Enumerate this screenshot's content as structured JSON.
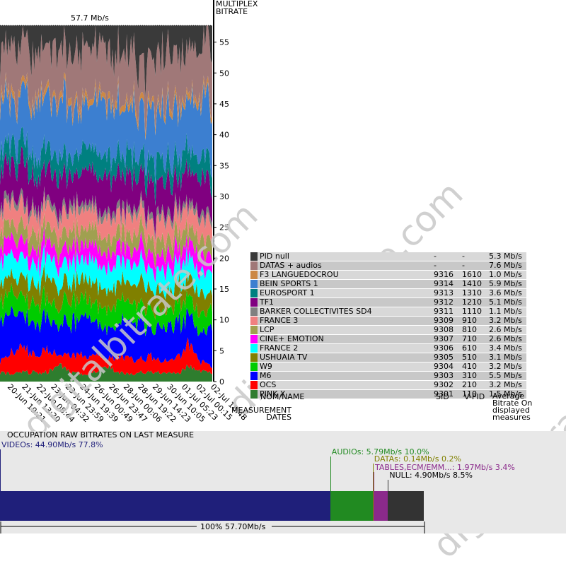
{
  "chart_data": {
    "type": "area",
    "title": "57.7 Mb/s",
    "ylabel": "MULTIPLEX BITRATE",
    "xlabel": "MEASUREMENT DATES",
    "ylim": [
      0,
      57.7
    ],
    "yticks": [
      0,
      5,
      10,
      15,
      20,
      25,
      30,
      35,
      40,
      45,
      50,
      55
    ],
    "x_ticks": [
      "20-Jun 19:21",
      "21-Jun 13:20",
      "22-Jun 08:44",
      "23-Jun 04:32",
      "23-Jun 23:59",
      "24-Jun 19:39",
      "26-Jun 00:49",
      "26-Jun 23:47",
      "28-Jun 00:06",
      "28-Jun 19:22",
      "29-Jun 14:23",
      "30-Jun 10:05",
      "01-Jul 05:23",
      "02-Jul 00:15",
      "02-Jul 18:48"
    ],
    "series": [
      {
        "name": "PINK X",
        "color": "#2e7d2e",
        "values": [
          1.5,
          1.2,
          1.5,
          1.5,
          1.5,
          2.8,
          1.5,
          1.2,
          1.6,
          2.8,
          1.5,
          1.2,
          1.5,
          1.5,
          1.5,
          1.2,
          2.8,
          1.5,
          1.5
        ]
      },
      {
        "name": "OCS",
        "color": "#ff0000",
        "values": [
          2.0,
          3.5,
          4.0,
          2.5,
          4.0,
          1.5,
          2.5,
          3.0,
          3.0,
          1.0,
          2.5,
          2.5,
          2.0,
          2.5,
          2.0,
          2.5,
          4.0,
          1.5,
          1.0
        ]
      },
      {
        "name": "M6",
        "color": "#0000ff",
        "values": [
          6.0,
          6.5,
          5.0,
          4.5,
          5.5,
          5.0,
          5.0,
          6.5,
          5.5,
          4.5,
          5.5,
          6.0,
          6.0,
          4.5,
          5.5,
          6.0,
          4.5,
          5.0,
          6.0
        ]
      },
      {
        "name": "W9",
        "color": "#00cc00",
        "values": [
          3.0,
          3.5,
          3.0,
          3.5,
          3.0,
          3.0,
          3.5,
          3.0,
          3.0,
          3.0,
          3.5,
          3.0,
          3.0,
          3.0,
          3.0,
          3.0,
          3.0,
          3.0,
          3.0
        ]
      },
      {
        "name": "USHUAIA TV",
        "color": "#808000",
        "values": [
          3.0,
          2.5,
          3.0,
          3.0,
          3.5,
          3.0,
          3.0,
          3.5,
          3.0,
          3.0,
          3.0,
          3.0,
          3.5,
          3.0,
          3.0,
          3.0,
          3.0,
          3.0,
          3.0
        ]
      },
      {
        "name": "FRANCE 2",
        "color": "#00ffff",
        "values": [
          3.5,
          3.5,
          3.0,
          3.5,
          3.0,
          3.5,
          3.5,
          3.0,
          3.5,
          3.5,
          3.5,
          3.0,
          3.5,
          3.0,
          3.5,
          3.5,
          3.0,
          3.5,
          3.5
        ]
      },
      {
        "name": "CINE+ EMOTION",
        "color": "#ff00ff",
        "values": [
          2.5,
          2.5,
          2.5,
          2.5,
          2.5,
          2.5,
          2.5,
          2.5,
          2.5,
          2.5,
          2.5,
          2.5,
          2.5,
          2.5,
          2.5,
          2.5,
          2.5,
          2.5,
          2.5
        ]
      },
      {
        "name": "LCP",
        "color": "#a0a050",
        "values": [
          2.5,
          2.5,
          2.5,
          2.5,
          2.5,
          2.5,
          2.5,
          2.5,
          2.5,
          2.5,
          2.5,
          2.5,
          2.5,
          2.5,
          2.5,
          2.5,
          2.5,
          2.5,
          2.5
        ]
      },
      {
        "name": "FRANCE 3",
        "color": "#f08080",
        "values": [
          3.0,
          3.0,
          3.0,
          3.0,
          3.0,
          3.0,
          3.0,
          3.0,
          3.0,
          3.0,
          3.0,
          3.0,
          3.0,
          3.0,
          3.0,
          3.0,
          3.0,
          3.0,
          3.0
        ]
      },
      {
        "name": "BARKER COLLECTIVITES SD4",
        "color": "#808080",
        "values": [
          1.1,
          1.1,
          1.1,
          1.1,
          1.1,
          1.1,
          1.1,
          1.1,
          1.1,
          1.1,
          1.1,
          1.1,
          1.1,
          1.1,
          1.1,
          1.1,
          1.1,
          1.1,
          1.1
        ]
      },
      {
        "name": "TF1",
        "color": "#800080",
        "values": [
          5.0,
          5.0,
          5.5,
          5.0,
          5.0,
          5.5,
          5.0,
          5.0,
          5.0,
          5.5,
          5.0,
          5.0,
          5.0,
          5.5,
          5.0,
          5.0,
          5.0,
          5.5,
          5.0
        ]
      },
      {
        "name": "EUROSPORT 1",
        "color": "#008080",
        "values": [
          3.5,
          3.0,
          4.0,
          3.5,
          3.5,
          3.5,
          3.0,
          4.0,
          3.5,
          3.5,
          3.5,
          3.5,
          3.0,
          4.0,
          3.5,
          3.5,
          3.5,
          3.5,
          3.5
        ]
      },
      {
        "name": "BEIN SPORTS 1",
        "color": "#3c7fd0",
        "values": [
          8.2,
          7.0,
          8.2,
          8.7,
          7.7,
          8.9,
          9.2,
          6.0,
          7.6,
          9.0,
          7.7,
          7.8,
          7.2,
          8.4,
          8.2,
          7.5,
          7.4,
          8.9,
          8.9
        ]
      },
      {
        "name": "F3 LANGUEDOCROU",
        "color": "#cc8844",
        "values": [
          1.0,
          1.0,
          1.0,
          1.0,
          1.0,
          1.0,
          1.0,
          1.0,
          1.0,
          1.0,
          1.0,
          1.0,
          1.0,
          1.0,
          1.0,
          1.0,
          1.0,
          1.0,
          1.0
        ]
      },
      {
        "name": "DATAS + audios",
        "color": "#a07878",
        "values": [
          7.6,
          7.6,
          7.6,
          7.6,
          7.6,
          7.6,
          7.6,
          7.6,
          7.6,
          7.6,
          7.6,
          7.6,
          7.6,
          7.6,
          7.6,
          7.6,
          7.6,
          7.6,
          7.6
        ]
      },
      {
        "name": "PID null",
        "color": "#3a3a3a",
        "values": [
          5.3,
          5.3,
          4.5,
          5.2,
          4.7,
          4.5,
          5.1,
          5.5,
          5.3,
          5.0,
          4.7,
          5.2,
          5.3,
          5.0,
          5.1,
          5.3,
          5.3,
          5.1,
          5.0
        ]
      }
    ]
  },
  "watermark": "digitalbitrate.com",
  "legend": {
    "header": {
      "name": "NOM/NAME",
      "sid": "SID",
      "vpid": "V-PID",
      "bitrate": "Average Bitrate On displayed measures"
    },
    "rows": [
      {
        "name": "PID null",
        "sid": "-",
        "vpid": "-",
        "bitrate": "5.3 Mb/s",
        "color": "#3a3a3a"
      },
      {
        "name": "DATAS + audios",
        "sid": "-",
        "vpid": "-",
        "bitrate": "7.6 Mb/s",
        "color": "#a07878"
      },
      {
        "name": "F3 LANGUEDOCROU",
        "sid": "9316",
        "vpid": "1610",
        "bitrate": "1.0 Mb/s",
        "color": "#cc8844"
      },
      {
        "name": "BEIN SPORTS 1",
        "sid": "9314",
        "vpid": "1410",
        "bitrate": "5.9 Mb/s",
        "color": "#3c7fd0"
      },
      {
        "name": "EUROSPORT 1",
        "sid": "9313",
        "vpid": "1310",
        "bitrate": "3.6 Mb/s",
        "color": "#008080"
      },
      {
        "name": "TF1",
        "sid": "9312",
        "vpid": "1210",
        "bitrate": "5.1 Mb/s",
        "color": "#800080"
      },
      {
        "name": "BARKER COLLECTIVITES SD4",
        "sid": "9311",
        "vpid": "1110",
        "bitrate": "1.1 Mb/s",
        "color": "#808080"
      },
      {
        "name": "FRANCE 3",
        "sid": "9309",
        "vpid": "910",
        "bitrate": "3.2 Mb/s",
        "color": "#f08080"
      },
      {
        "name": "LCP",
        "sid": "9308",
        "vpid": "810",
        "bitrate": "2.6 Mb/s",
        "color": "#a0a050"
      },
      {
        "name": "CINE+ EMOTION",
        "sid": "9307",
        "vpid": "710",
        "bitrate": "2.6 Mb/s",
        "color": "#ff00ff"
      },
      {
        "name": "FRANCE 2",
        "sid": "9306",
        "vpid": "610",
        "bitrate": "3.4 Mb/s",
        "color": "#00ffff"
      },
      {
        "name": "USHUAIA TV",
        "sid": "9305",
        "vpid": "510",
        "bitrate": "3.1 Mb/s",
        "color": "#808000"
      },
      {
        "name": "W9",
        "sid": "9304",
        "vpid": "410",
        "bitrate": "3.2 Mb/s",
        "color": "#00cc00"
      },
      {
        "name": "M6",
        "sid": "9303",
        "vpid": "310",
        "bitrate": "5.5 Mb/s",
        "color": "#0000ff"
      },
      {
        "name": "OCS",
        "sid": "9302",
        "vpid": "210",
        "bitrate": "3.2 Mb/s",
        "color": "#ff0000"
      },
      {
        "name": "PINK X",
        "sid": "9301",
        "vpid": "110",
        "bitrate": "1.5 Mb/s",
        "color": "#2e7d2e"
      }
    ]
  },
  "occupation": {
    "title": "OCCUPATION RAW BITRATES ON LAST MEASURE",
    "total_label": "100%  57.70Mb/s",
    "segments": [
      {
        "label": "VIDEOs: 44.90Mb/s  77.8%",
        "percent": 77.8,
        "color": "#1f1f7a"
      },
      {
        "label": "AUDIOs: 5.79Mb/s  10.0%",
        "percent": 10.0,
        "color": "#218a21"
      },
      {
        "label": "DATAs: 0.14Mb/s  0.2%",
        "percent": 0.2,
        "color": "#808000"
      },
      {
        "label": "TABLES,ECM/EMM...: 1.97Mb/s  3.4%",
        "percent": 3.4,
        "color": "#8b2a8b"
      },
      {
        "label": "NULL: 4.90Mb/s  8.5%",
        "percent": 8.5,
        "color": "#333333"
      }
    ]
  }
}
